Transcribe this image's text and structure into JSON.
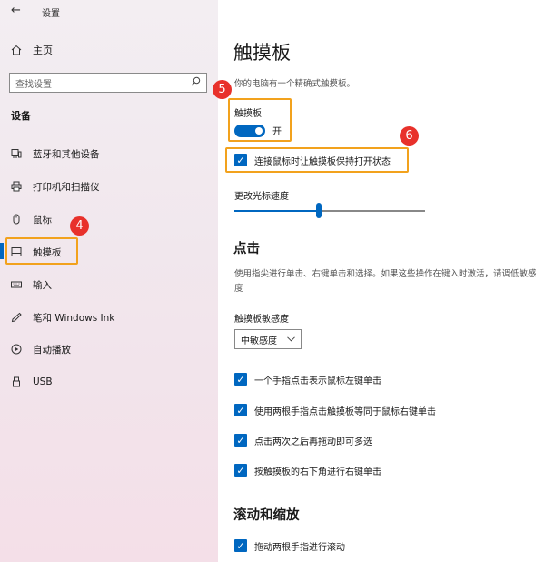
{
  "window": {
    "title": "设置"
  },
  "sidebar": {
    "home_label": "主页",
    "search_placeholder": "查找设置",
    "section_heading": "设备",
    "items": [
      {
        "label": "蓝牙和其他设备",
        "icon": "bluetooth-devices-icon"
      },
      {
        "label": "打印机和扫描仪",
        "icon": "printer-icon"
      },
      {
        "label": "鼠标",
        "icon": "mouse-icon"
      },
      {
        "label": "触摸板",
        "icon": "touchpad-icon",
        "active": true
      },
      {
        "label": "输入",
        "icon": "keyboard-icon"
      },
      {
        "label": "笔和 Windows Ink",
        "icon": "pen-icon"
      },
      {
        "label": "自动播放",
        "icon": "autoplay-icon"
      },
      {
        "label": "USB",
        "icon": "usb-icon"
      }
    ]
  },
  "main": {
    "title": "触摸板",
    "description": "你的电脑有一个精确式触摸板。",
    "touchpad_toggle": {
      "label": "触摸板",
      "state_label": "开",
      "on": true
    },
    "keep_on_with_mouse": {
      "label": "连接鼠标时让触摸板保持打开状态",
      "checked": true
    },
    "cursor_speed": {
      "label": "更改光标速度",
      "value_fraction": 0.44
    },
    "tap_section": {
      "title": "点击",
      "description": "使用指尖进行单击、右键单击和选择。如果这些操作在键入时激活，请调低敏感度",
      "sensitivity_label": "触摸板敏感度",
      "sensitivity_value": "中敏感度",
      "options": [
        {
          "label": "一个手指点击表示鼠标左键单击",
          "checked": true
        },
        {
          "label": "使用两根手指点击触摸板等同于鼠标右键单击",
          "checked": true
        },
        {
          "label": "点击两次之后再拖动即可多选",
          "checked": true
        },
        {
          "label": "按触摸板的右下角进行右键单击",
          "checked": true
        }
      ]
    },
    "scroll_section": {
      "title": "滚动和缩放",
      "options": [
        {
          "label": "拖动两根手指进行滚动",
          "checked": true
        }
      ]
    }
  },
  "annotations": {
    "badge_4": "4",
    "badge_5": "5",
    "badge_6": "6"
  },
  "colors": {
    "accent": "#0067c0",
    "highlight": "#f2a21d",
    "badge": "#e8312b"
  }
}
